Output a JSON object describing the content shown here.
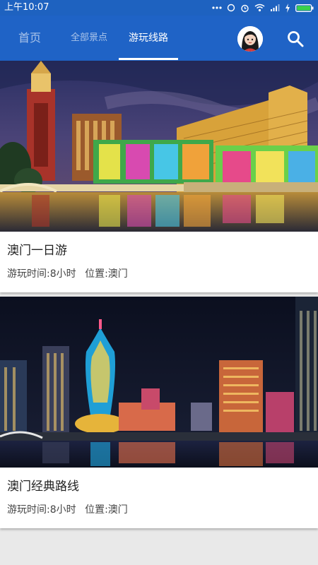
{
  "status_bar": {
    "time": "上午10:07",
    "icons": [
      "more-dots-icon",
      "sync-icon",
      "alarm-icon",
      "wifi-icon",
      "signal-icon",
      "charging-icon",
      "battery-icon"
    ]
  },
  "tabs": [
    {
      "label": "首页",
      "selected": false
    },
    {
      "label": "全部景点",
      "selected": false
    },
    {
      "label": "游玩线路",
      "selected": true
    }
  ],
  "routes": [
    {
      "title": "澳门一日游",
      "duration": "游玩时间:8小时",
      "location": "位置:澳门",
      "image": "venetian-macao-night-photo"
    },
    {
      "title": "澳门经典路线",
      "duration": "游玩时间:8小时",
      "location": "位置:澳门",
      "image": "grand-lisboa-night-skyline-photo"
    }
  ],
  "colors": {
    "primary": "#1f63c6",
    "status_bar": "#1e62c0",
    "background": "#e9e9e9"
  }
}
